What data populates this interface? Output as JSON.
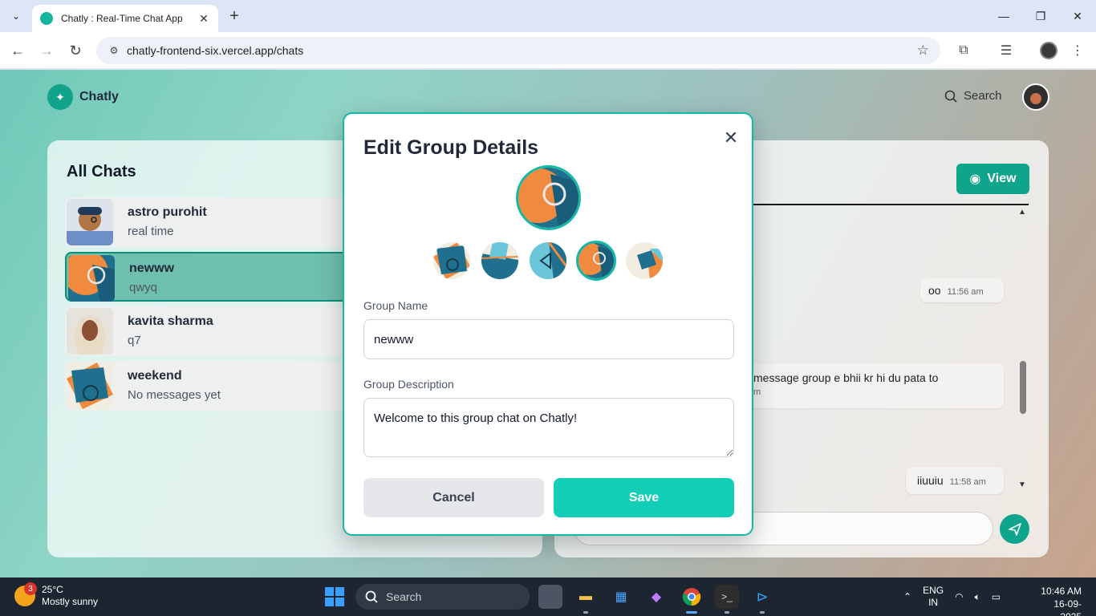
{
  "browser": {
    "tab_title": "Chatly : Real-Time Chat App",
    "url": "chatly-frontend-six.vercel.app/chats"
  },
  "app": {
    "logo_text": "Chatly",
    "search_label": "Search"
  },
  "chats_panel": {
    "title": "All Chats",
    "items": [
      {
        "name": "astro purohit",
        "last": "real time",
        "thumb": "man-avatar"
      },
      {
        "name": "newww",
        "last": "qwyq",
        "thumb": "group-avatar-orange"
      },
      {
        "name": "kavita sharma",
        "last": "q7",
        "thumb": "woman-avatar"
      },
      {
        "name": "weekend",
        "last": "No messages yet",
        "thumb": "group-avatar-blue"
      }
    ]
  },
  "chat_panel": {
    "view_label": "View",
    "messages": [
      {
        "text": "oo",
        "time": "11:56 am"
      },
      {
        "text": "message group e bhii kr hi du pata to",
        "time": "m"
      },
      {
        "text": "iiuuiu",
        "time": "11:58 am"
      }
    ]
  },
  "modal": {
    "title": "Edit Group Details",
    "group_name_label": "Group Name",
    "group_name_value": "newww",
    "group_desc_label": "Group Description",
    "group_desc_value": "Welcome to this group chat on Chatly!",
    "cancel_label": "Cancel",
    "save_label": "Save",
    "selected_avatar_index": 3
  },
  "taskbar": {
    "weather_badge": "3",
    "temperature": "25°C",
    "condition": "Mostly sunny",
    "search_label": "Search",
    "lang_primary": "ENG",
    "lang_secondary": "IN",
    "time": "10:46 AM",
    "date": "16-09-2025"
  },
  "colors": {
    "accent": "#14b8a6",
    "accent_dark": "#0fa58d",
    "save_button": "#14cfb8"
  }
}
